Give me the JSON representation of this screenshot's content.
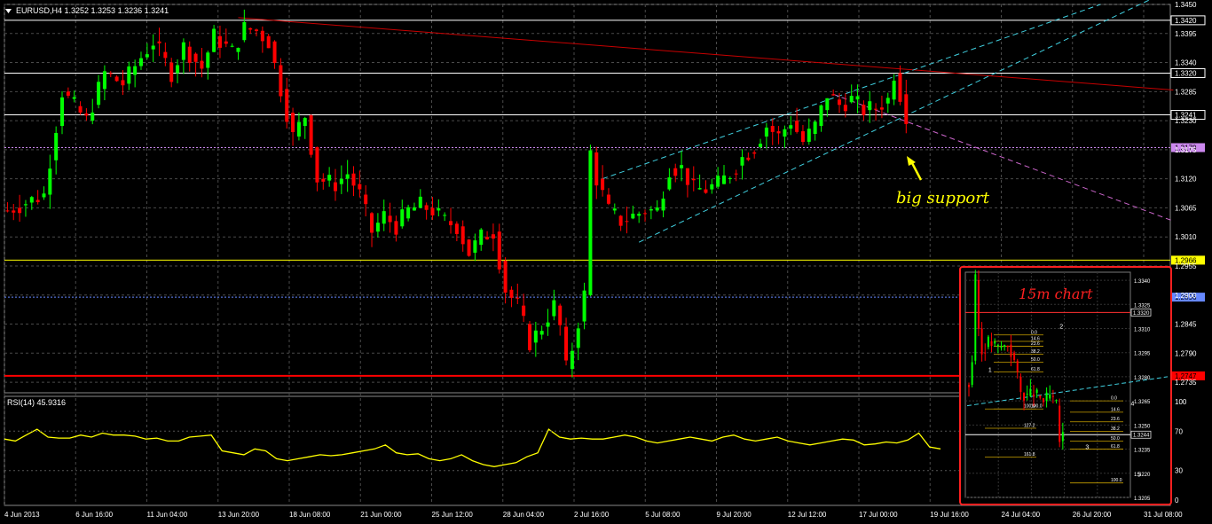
{
  "header": {
    "symbol_line": "EURUSD,H4  1.3252 1.3253 1.3236 1.3241",
    "rsi_label": "RSI(14) 45.9316"
  },
  "colors": {
    "bull": "#00ff00",
    "bear": "#ff0000",
    "grid": "#4a4a4a",
    "rsi": "#ffff00",
    "trendline": "#c80000",
    "channel": "#40d0e0",
    "support_line": "#cc66cc",
    "annotation": "#ffff00",
    "inset_border": "#ff2020"
  },
  "annotations": {
    "big_support": "big support",
    "inset_title": "15m chart"
  },
  "chart_data": [
    {
      "type": "candlestick",
      "title": "EURUSD,H4",
      "ohlc_last": {
        "open": 1.3252,
        "high": 1.3253,
        "low": 1.3236,
        "close": 1.3241
      },
      "ylim": [
        1.2715,
        1.345
      ],
      "y_ticks": [
        "1.3450",
        "1.3395",
        "1.3340",
        "1.3285",
        "1.3230",
        "1.3175",
        "1.3120",
        "1.3065",
        "1.3010",
        "1.2955",
        "1.2900",
        "1.2845",
        "1.2790",
        "1.2735"
      ],
      "x_ticks": [
        "4 Jun 2013",
        "6 Jun 16:00",
        "11 Jun 04:00",
        "13 Jun 20:00",
        "18 Jun 08:00",
        "21 Jun 00:00",
        "25 Jun 12:00",
        "28 Jun 04:00",
        "2 Jul 16:00",
        "5 Jul 08:00",
        "9 Jul 20:00",
        "12 Jul 12:00",
        "17 Jul 00:00",
        "19 Jul 16:00",
        "24 Jul 04:00",
        "26 Jul 20:00",
        "31 Jul 08:00"
      ],
      "price_levels": [
        {
          "label": "1.3420",
          "value": 1.342,
          "color": "#ffffff"
        },
        {
          "label": "1.3320",
          "value": 1.332,
          "color": "#ffffff"
        },
        {
          "label": "1.3241",
          "value": 1.3241,
          "color": "#ffffff"
        },
        {
          "label": "1.3179",
          "value": 1.3179,
          "color": "#cc88ee"
        },
        {
          "label": "1.2966",
          "value": 1.2966,
          "color": "#ffff00"
        },
        {
          "label": "1.2896",
          "value": 1.2896,
          "color": "#6688ff"
        },
        {
          "label": "1.2747",
          "value": 1.2747,
          "color": "#ff0000"
        }
      ],
      "path": [
        [
          0,
          1.306
        ],
        [
          6,
          1.309
        ],
        [
          9,
          1.3285
        ],
        [
          13,
          1.323
        ],
        [
          16,
          1.332
        ],
        [
          19,
          1.33
        ],
        [
          22,
          1.335
        ],
        [
          24,
          1.338
        ],
        [
          27,
          1.332
        ],
        [
          29,
          1.337
        ],
        [
          32,
          1.333
        ],
        [
          34,
          1.339
        ],
        [
          37,
          1.336
        ],
        [
          39,
          1.3405
        ],
        [
          41,
          1.34
        ],
        [
          43,
          1.338
        ],
        [
          45,
          1.329
        ],
        [
          47,
          1.32
        ],
        [
          49,
          1.324
        ],
        [
          51,
          1.312
        ],
        [
          54,
          1.311
        ],
        [
          56,
          1.313
        ],
        [
          58,
          1.309
        ],
        [
          60,
          1.302
        ],
        [
          62,
          1.305
        ],
        [
          64,
          1.303
        ],
        [
          66,
          1.306
        ],
        [
          68,
          1.307
        ],
        [
          70,
          1.306
        ],
        [
          72,
          1.304
        ],
        [
          74,
          1.303
        ],
        [
          76,
          1.298
        ],
        [
          78,
          1.301
        ],
        [
          80,
          1.302
        ],
        [
          82,
          1.291
        ],
        [
          84,
          1.288
        ],
        [
          86,
          1.281
        ],
        [
          88,
          1.284
        ],
        [
          90,
          1.288
        ],
        [
          91,
          1.284
        ],
        [
          92,
          1.276
        ],
        [
          93,
          1.28
        ],
        [
          95,
          1.29
        ],
        [
          96,
          1.317
        ],
        [
          97,
          1.312
        ],
        [
          99,
          1.306
        ],
        [
          101,
          1.304
        ],
        [
          103,
          1.305
        ],
        [
          105,
          1.306
        ],
        [
          107,
          1.306
        ],
        [
          109,
          1.314
        ],
        [
          111,
          1.314
        ],
        [
          113,
          1.31
        ],
        [
          115,
          1.31
        ],
        [
          117,
          1.311
        ],
        [
          119,
          1.313
        ],
        [
          121,
          1.316
        ],
        [
          123,
          1.318
        ],
        [
          125,
          1.322
        ],
        [
          127,
          1.32
        ],
        [
          129,
          1.323
        ],
        [
          131,
          1.319
        ],
        [
          133,
          1.322
        ],
        [
          135,
          1.328
        ],
        [
          137,
          1.326
        ],
        [
          139,
          1.327
        ],
        [
          141,
          1.325
        ],
        [
          143,
          1.3255
        ],
        [
          145,
          1.327
        ],
        [
          146,
          1.332
        ],
        [
          147,
          1.328
        ],
        [
          148,
          1.3241
        ]
      ],
      "trendlines": [
        {
          "name": "resistance",
          "from": [
            38,
            1.3425
          ],
          "to": [
            192,
            1.3288
          ]
        },
        {
          "name": "channel-lower",
          "from": [
            104,
            1.3
          ],
          "to": [
            192,
            1.348
          ]
        },
        {
          "name": "channel-upper",
          "from": [
            98,
            1.312
          ],
          "to": [
            180,
            1.345
          ]
        },
        {
          "name": "support-extension",
          "from": [
            136,
            1.328
          ],
          "to": [
            192,
            1.304
          ]
        }
      ]
    },
    {
      "type": "line",
      "title": "RSI(14)",
      "current": 45.9316,
      "ylim": [
        0,
        100
      ],
      "y_ticks": [
        "100",
        "70",
        "30",
        "0"
      ],
      "series": [
        {
          "values": [
            62,
            60,
            66,
            72,
            64,
            63,
            63,
            66,
            64,
            68,
            66,
            66,
            65,
            62,
            63,
            60,
            60,
            64,
            65,
            66,
            50,
            48,
            46,
            52,
            50,
            42,
            40,
            42,
            44,
            46,
            45,
            46,
            48,
            50,
            52,
            56,
            48,
            46,
            47,
            42,
            40,
            42,
            46,
            40,
            36,
            34,
            36,
            38,
            44,
            48,
            72,
            64,
            62,
            63,
            62,
            62,
            64,
            66,
            64,
            60,
            58,
            60,
            62,
            64,
            62,
            60,
            64,
            66,
            62,
            60,
            62,
            64,
            60,
            58,
            56,
            58,
            60,
            62,
            61,
            56,
            57,
            59,
            58,
            61,
            68,
            54,
            52
          ]
        }
      ]
    },
    {
      "type": "candlestick",
      "title": "15m chart",
      "ylim": [
        1.3205,
        1.3345
      ],
      "y_ticks": [
        "1.3340",
        "1.3325",
        "1.3310",
        "1.3295",
        "1.3280",
        "1.3265",
        "1.3250",
        "1.3235",
        "1.3220",
        "1.3205"
      ],
      "price_levels": [
        {
          "label": "1.3320",
          "value": 1.332
        },
        {
          "label": "1.3244",
          "value": 1.3244
        }
      ],
      "fib_top": {
        "labels": [
          "0.0",
          "14.6",
          "23.6",
          "38.2",
          "50.0",
          "61.8",
          "100.0"
        ],
        "values": [
          1.3306,
          1.3302,
          1.3299,
          1.3294,
          1.3289,
          1.3283,
          1.326
        ]
      },
      "fib_bottom": {
        "labels": [
          "0.0",
          "14.6",
          "23.6",
          "38.2",
          "50.0",
          "61.8",
          "100.0"
        ],
        "values": [
          1.3265,
          1.3258,
          1.3252,
          1.3246,
          1.324,
          1.3235,
          1.3214
        ]
      },
      "fib_ext": {
        "labels": [
          "100.0",
          "127.2",
          "161.8"
        ],
        "values": [
          1.326,
          1.3248,
          1.323
        ]
      },
      "wave_labels": [
        "1",
        "2",
        "3",
        "4",
        "5"
      ],
      "path": [
        [
          0,
          1.3275
        ],
        [
          1,
          1.329
        ],
        [
          2,
          1.334
        ],
        [
          3,
          1.331
        ],
        [
          4,
          1.3295
        ],
        [
          6,
          1.3302
        ],
        [
          9,
          1.3298
        ],
        [
          12,
          1.33
        ],
        [
          14,
          1.329
        ],
        [
          16,
          1.327
        ],
        [
          18,
          1.3268
        ],
        [
          20,
          1.327
        ],
        [
          23,
          1.3265
        ],
        [
          25,
          1.3268
        ],
        [
          27,
          1.3262
        ],
        [
          28,
          1.324
        ],
        [
          29,
          1.3244
        ]
      ]
    }
  ]
}
